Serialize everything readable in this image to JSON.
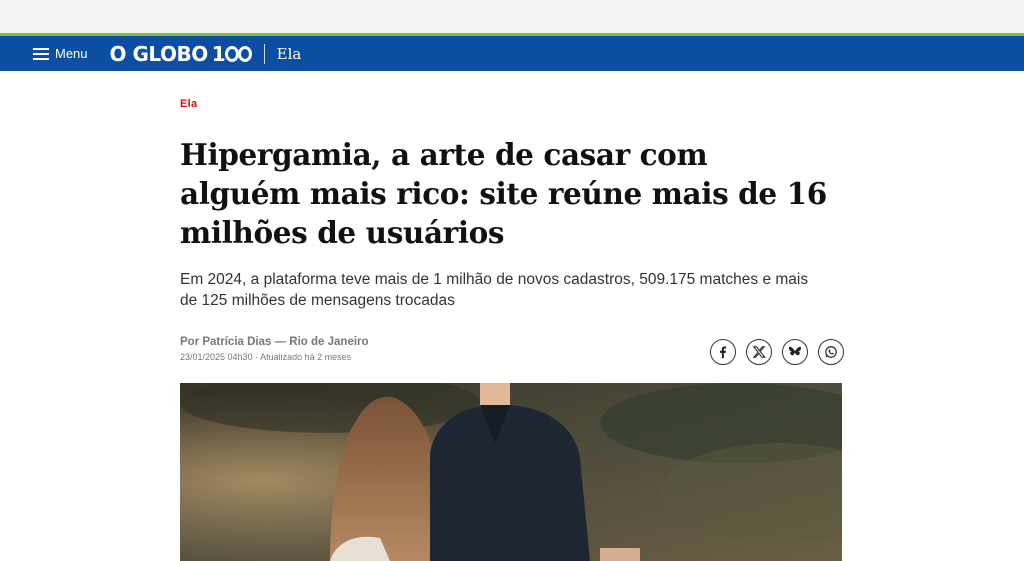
{
  "header": {
    "menu_label": "Menu",
    "logo_text": "O GLOBO",
    "logo_badge": "100",
    "section": "Ela",
    "brand_color": "#0b4ea2",
    "accent_color": "#7bc043"
  },
  "article": {
    "kicker": "Ela",
    "headline": "Hipergamia, a arte de casar com alguém mais rico: site reúne mais de 16 milhões de usuários",
    "subtitle": "Em 2024, a plataforma teve mais de 1 milhão de novos cadastros, 509.175 matches e mais de 125 milhões de mensagens trocadas",
    "author": "Por Patrícia Dias — Rio de Janeiro",
    "dateline": "23/01/2025 04h30 · Atualizado há 2 meses",
    "kicker_color": "#c4170c"
  },
  "share": {
    "icons": [
      "facebook-icon",
      "x-icon",
      "bluesky-icon",
      "whatsapp-icon"
    ]
  }
}
